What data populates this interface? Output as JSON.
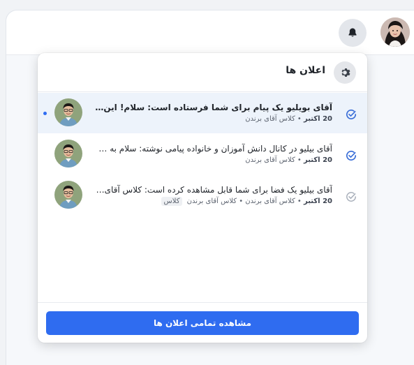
{
  "topbar": {
    "bell_icon": "bell-icon",
    "avatar_icon": "user-avatar"
  },
  "notifications": {
    "title": "اعلان ها",
    "settings_icon": "gear-icon",
    "items": [
      {
        "title": "آقای بویلیو یک پیام برای شما فرستاده است: سلام! این کانال…",
        "date": "20 اکتبر",
        "meta": " • کلاس آقای برندن",
        "chip": "",
        "unread": true
      },
      {
        "title": "آقای بیلیو در کانال دانش آموزان و خانواده پیامی نوشته: سلام به همه!…",
        "date": "20 اکتبر",
        "meta": " • کلاس آقای برندن",
        "chip": "",
        "unread": false
      },
      {
        "title": "آقای بیلیو یک فضا برای شما قابل مشاهده کرده است: کلاس آقای بیلیو",
        "date": "20 اکتبر",
        "meta": " • کلاس آقای برندن • کلاس آقای برندن",
        "chip": "کلاس",
        "unread": false
      }
    ],
    "view_all_label": "مشاهده تمامی اعلان ها"
  },
  "colors": {
    "accent": "#2f6cf0",
    "unread_bg": "#edf3fb",
    "check_active": "#3b6fd8",
    "check_inactive": "#a9b0bb"
  }
}
